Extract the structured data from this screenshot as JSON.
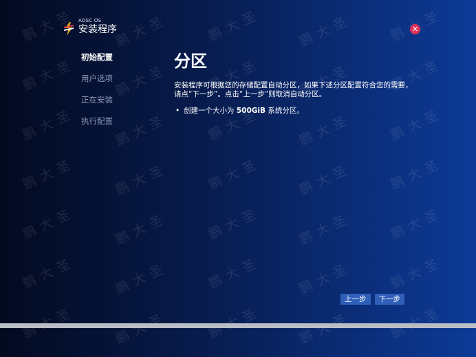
{
  "brand": {
    "small_label": "AOSC OS",
    "title": "安装程序",
    "logo_icon": "aosc-logo-icon"
  },
  "close_icon": "close-icon",
  "steps": [
    {
      "label": "初始配置",
      "active": true
    },
    {
      "label": "用户选项",
      "active": false
    },
    {
      "label": "正在安装",
      "active": false
    },
    {
      "label": "执行配置",
      "active": false
    }
  ],
  "main": {
    "title": "分区",
    "description": "安装程序可根据您的存储配置自动分区，如果下述分区配置符合您的需要，请点“下一步”。点击“上一步”则取消自动分区。",
    "plan": {
      "prefix": "创建一个大小为 ",
      "size": "500GiB",
      "suffix": " 系统分区。"
    }
  },
  "nav": {
    "back_label": "上一步",
    "next_label": "下一步"
  },
  "progress": {
    "value_percent": 100
  },
  "watermark": {
    "text": "鹏大圣"
  },
  "colors": {
    "accent_button": "#2f5fb8",
    "close_button": "#e0335a",
    "inactive_step": "#8e9ab8"
  }
}
